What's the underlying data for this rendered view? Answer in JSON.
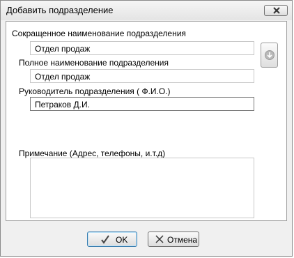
{
  "window": {
    "title": "Добавить подразделение"
  },
  "form": {
    "short_name": {
      "label": "Сокращенное наименование подразделения",
      "value": "Отдел продаж"
    },
    "full_name": {
      "label": "Полное наименование подразделения",
      "value": "Отдел продаж"
    },
    "head": {
      "label": "Руководитель подразделения ( Ф.И.О.)",
      "value": "Петраков Д.И."
    },
    "notes": {
      "label": "Примечание (Адрес, телефоны, и.т.д)",
      "value": ""
    }
  },
  "buttons": {
    "ok": "OK",
    "cancel": "Отмена"
  },
  "icons": {
    "close": "close-icon",
    "side": "arrow-down-icon",
    "ok": "checkmark-icon",
    "cancel": "x-icon"
  }
}
